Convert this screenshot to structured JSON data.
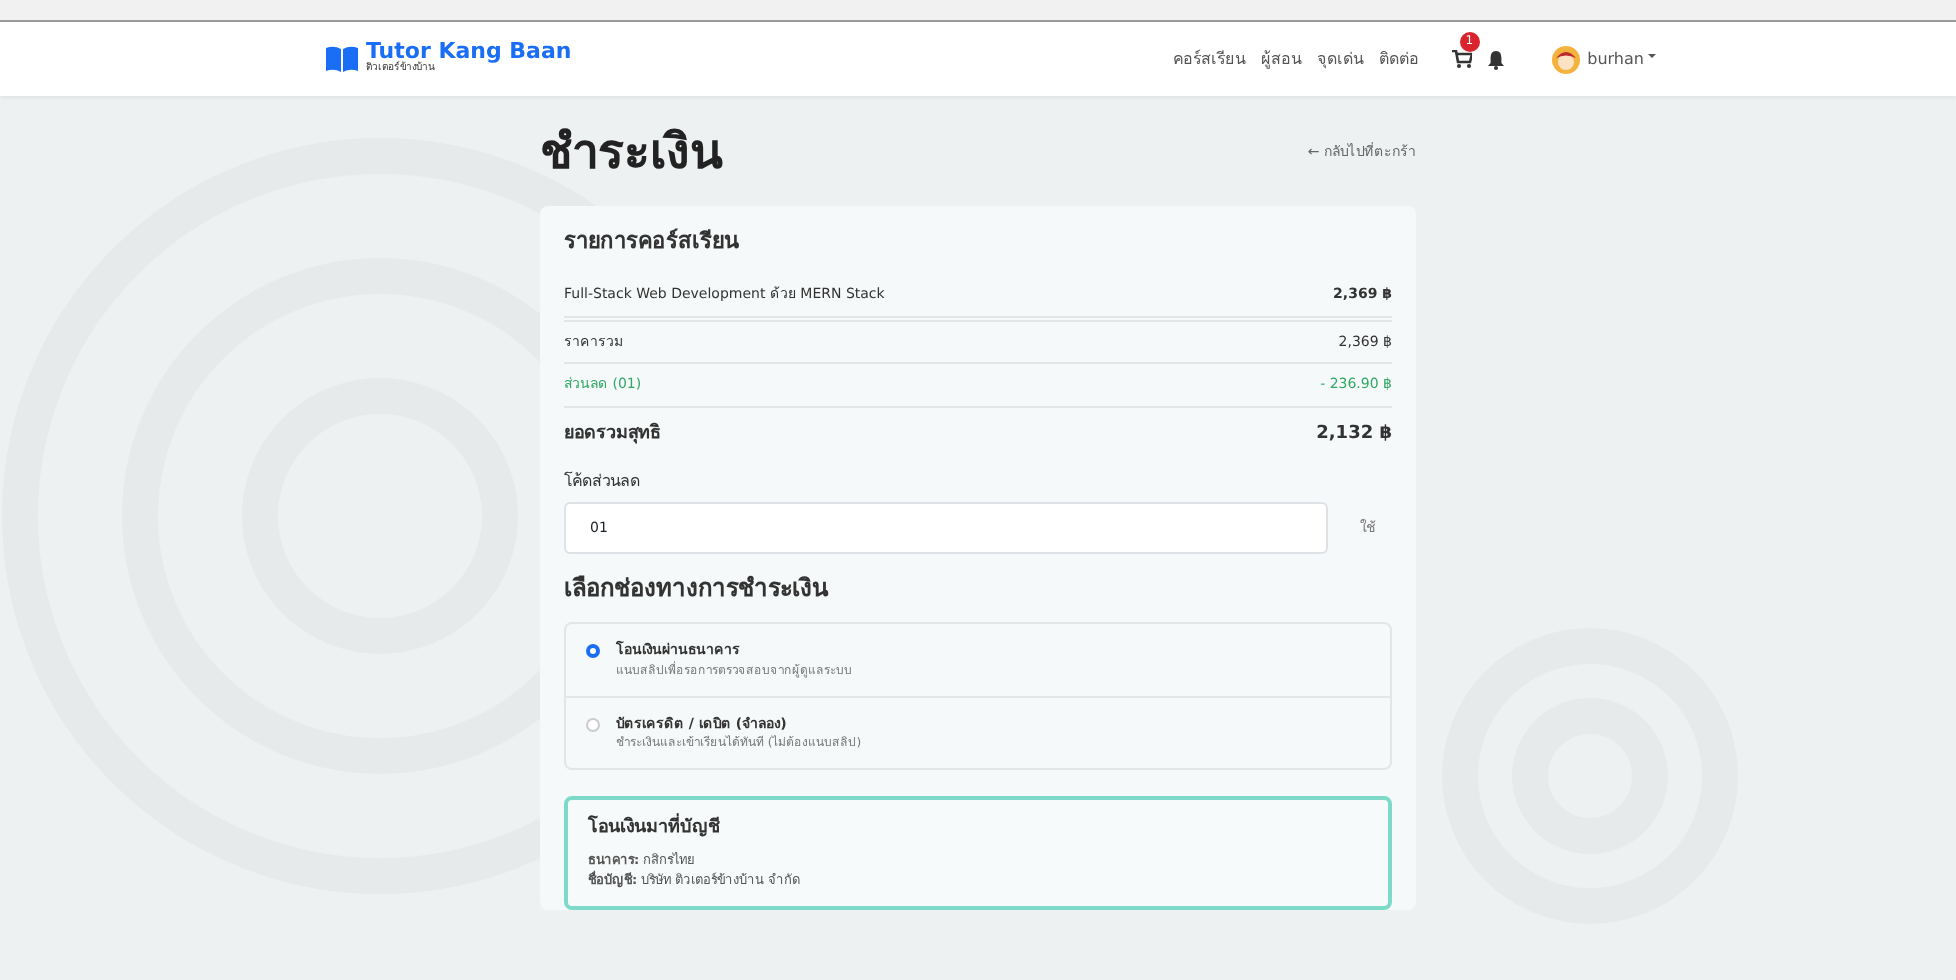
{
  "navbar": {
    "brand": "Tutor Kang Baan",
    "tagline": "ติวเตอร์ข้างบ้าน",
    "links": [
      "คอร์สเรียน",
      "ผู้สอน",
      "จุดเด่น",
      "ติดต่อ"
    ],
    "cart_badge": "1",
    "user": "burhan"
  },
  "page": {
    "title": "ชำระเงิน",
    "back_link": "← กลับไปที่ตะกร้า"
  },
  "order": {
    "title": "รายการคอร์สเรียน",
    "items": [
      {
        "name": "Full-Stack Web Development ด้วย MERN Stack",
        "price": "2,369 ฿"
      }
    ],
    "subtotal": {
      "label": "ราคารวม",
      "value": "2,369 ฿"
    },
    "discount": {
      "label": "ส่วนลด (01)",
      "value": "- 236.90 ฿"
    },
    "total": {
      "label": "ยอดรวมสุทธิ",
      "value": "2,132 ฿"
    },
    "coupon": {
      "label": "โค้ดส่วนลด",
      "value": "01",
      "button": "ใช้"
    },
    "payment_title": "เลือกช่องทางการชำระเงิน",
    "methods": [
      {
        "title": "โอนเงินผ่านธนาคาร",
        "description": "แนบสลิปเพื่อรอการตรวจสอบจากผู้ดูแลระบบ",
        "selected": true
      },
      {
        "title": "บัตรเครดิต / เดบิต (จำลอง)",
        "description": "ชำระเงินและเข้าเรียนได้ทันที (ไม่ต้องแนบสลิป)",
        "selected": false
      }
    ],
    "bank": {
      "title": "โอนเงินมาที่บัญชี",
      "lines": [
        "**ธนาคาร:** กสิกรไทย",
        "**ชื่อบัญชี:** บริษัท ติวเตอร์ข้างบ้าน จำกัด"
      ]
    }
  }
}
